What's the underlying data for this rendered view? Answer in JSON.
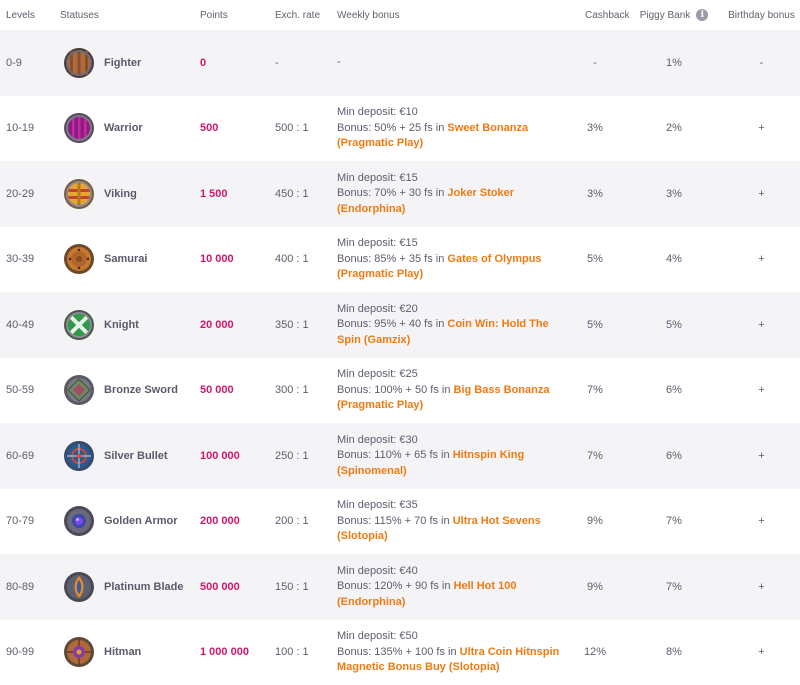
{
  "header": {
    "levels": "Levels",
    "statuses": "Statuses",
    "points": "Points",
    "rate": "Exch. rate",
    "weekly": "Weekly bonus",
    "cashback": "Cashback",
    "piggy": "Piggy Bank",
    "birthday": "Birthday bonus"
  },
  "colors": {
    "points": "#d0186a",
    "game": "#f07a12",
    "stripe": "#f4f4f7"
  },
  "rows": [
    {
      "level": "0-9",
      "status": "Fighter",
      "icon": "fighter-shield-icon",
      "points": "0",
      "rate": "-",
      "deposit": "-",
      "bonus": "",
      "game": "",
      "provider": "",
      "cashback": "-",
      "piggy": "1%",
      "birthday": "-"
    },
    {
      "level": "10-19",
      "status": "Warrior",
      "icon": "warrior-shield-icon",
      "points": "500",
      "rate": "500 : 1",
      "deposit": "Min deposit: €10",
      "bonus": "Bonus: 50% + 25 fs in ",
      "game": "Sweet Bonanza",
      "provider": "(Pragmatic Play)",
      "cashback": "3%",
      "piggy": "2%",
      "birthday": "+"
    },
    {
      "level": "20-29",
      "status": "Viking",
      "icon": "viking-shield-icon",
      "points": "1 500",
      "rate": "450 : 1",
      "deposit": "Min deposit: €15",
      "bonus": "Bonus: 70% + 30 fs in ",
      "game": "Joker Stoker",
      "provider": "(Endorphina)",
      "cashback": "3%",
      "piggy": "3%",
      "birthday": "+"
    },
    {
      "level": "30-39",
      "status": "Samurai",
      "icon": "samurai-shield-icon",
      "points": "10 000",
      "rate": "400 : 1",
      "deposit": "Min deposit: €15",
      "bonus": "Bonus: 85% + 35 fs in ",
      "game": "Gates of Olympus",
      "provider": "(Pragmatic Play)",
      "cashback": "5%",
      "piggy": "4%",
      "birthday": "+"
    },
    {
      "level": "40-49",
      "status": "Knight",
      "icon": "knight-shield-icon",
      "points": "20 000",
      "rate": "350 : 1",
      "deposit": "Min deposit: €20",
      "bonus": "Bonus: 95% + 40 fs in ",
      "game": "Coin Win: Hold The Spin (Gamzix)",
      "provider": "",
      "cashback": "5%",
      "piggy": "5%",
      "birthday": "+"
    },
    {
      "level": "50-59",
      "status": "Bronze Sword",
      "icon": "bronze-sword-shield-icon",
      "points": "50 000",
      "rate": "300 : 1",
      "deposit": "Min deposit: €25",
      "bonus": "Bonus: 100% + 50 fs in ",
      "game": "Big Bass Bonanza",
      "provider": "(Pragmatic Play)",
      "cashback": "7%",
      "piggy": "6%",
      "birthday": "+"
    },
    {
      "level": "60-69",
      "status": "Silver Bullet",
      "icon": "silver-bullet-shield-icon",
      "points": "100 000",
      "rate": "250 : 1",
      "deposit": "Min deposit: €30",
      "bonus": "Bonus: 110% + 65 fs in ",
      "game": "Hitnspin King",
      "provider": "(Spinomenal)",
      "cashback": "7%",
      "piggy": "6%",
      "birthday": "+"
    },
    {
      "level": "70-79",
      "status": "Golden Armor",
      "icon": "golden-armor-shield-icon",
      "points": "200 000",
      "rate": "200 : 1",
      "deposit": "Min deposit: €35",
      "bonus": "Bonus: 115% + 70 fs in ",
      "game": "Ultra Hot Sevens",
      "provider": "(Slotopia)",
      "cashback": "9%",
      "piggy": "7%",
      "birthday": "+"
    },
    {
      "level": "80-89",
      "status": "Platinum Blade",
      "icon": "platinum-blade-shield-icon",
      "points": "500 000",
      "rate": "150 : 1",
      "deposit": "Min deposit: €40",
      "bonus": "Bonus: 120% + 90 fs in ",
      "game": "Hell Hot 100",
      "provider": "(Endorphina)",
      "cashback": "9%",
      "piggy": "7%",
      "birthday": "+"
    },
    {
      "level": "90-99",
      "status": "Hitman",
      "icon": "hitman-shield-icon",
      "points": "1 000 000",
      "rate": "100 : 1",
      "deposit": "Min deposit: €50",
      "bonus": "Bonus: 135% + 100 fs in ",
      "game": "Ultra Coin Hitnspin Magnetic Bonus Buy (Slotopia)",
      "provider": "",
      "cashback": "12%",
      "piggy": "8%",
      "birthday": "+"
    }
  ]
}
